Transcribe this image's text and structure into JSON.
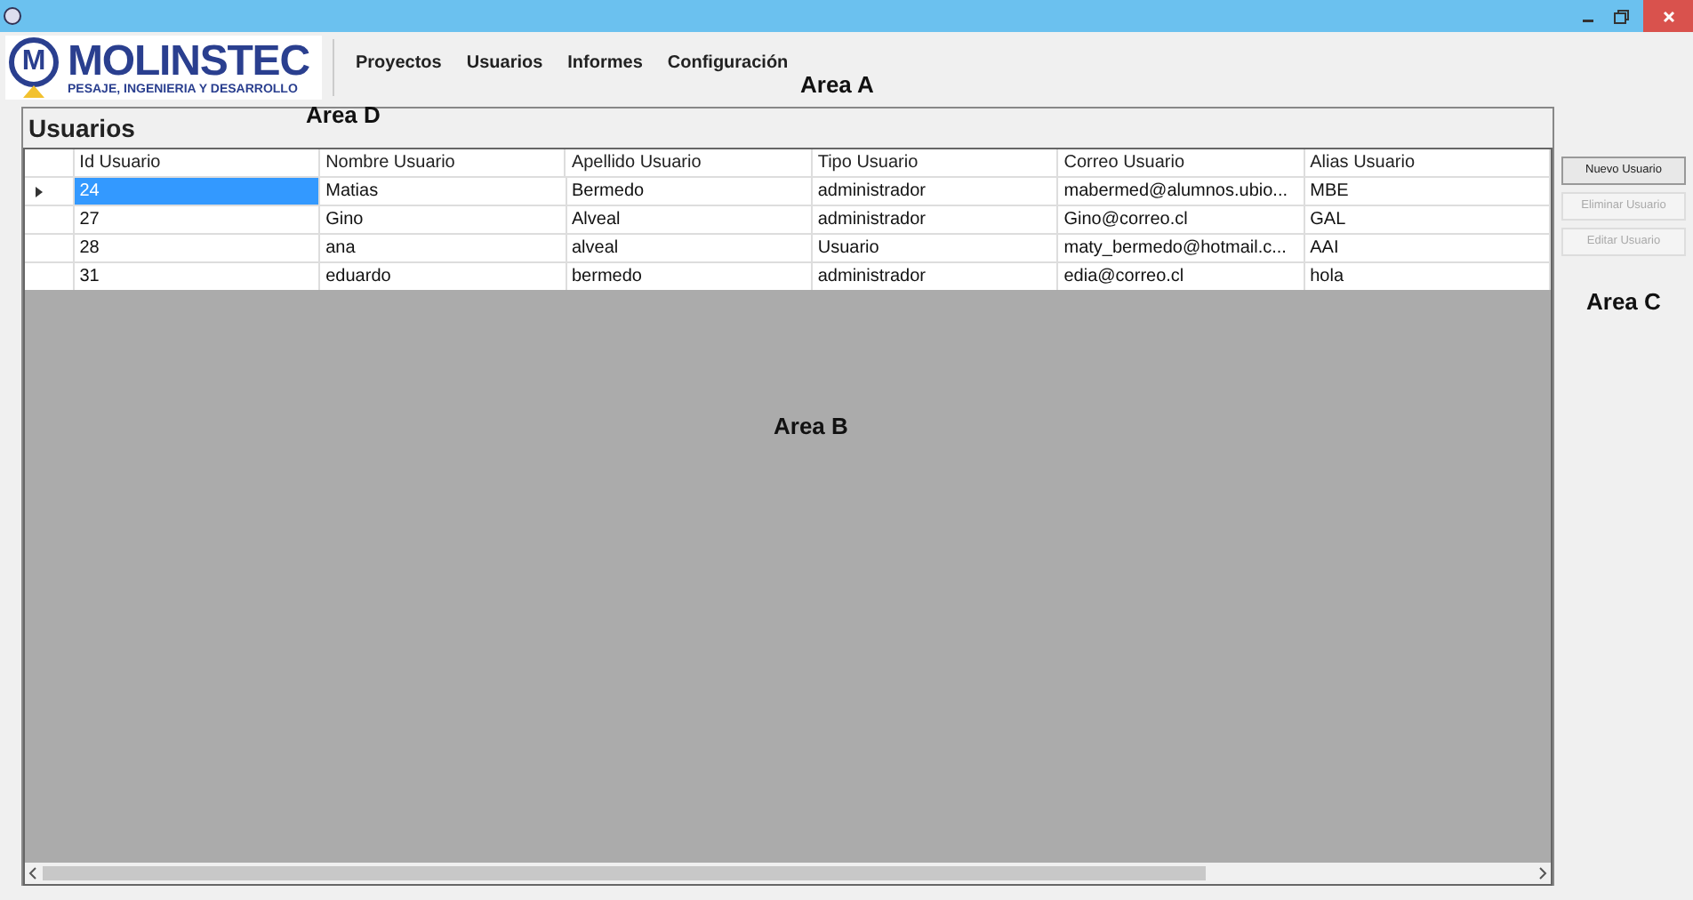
{
  "logo": {
    "mark": "M",
    "name": "MOLINSTEC",
    "tagline": "PESAJE, INGENIERIA Y DESARROLLO"
  },
  "menu": [
    "Proyectos",
    "Usuarios",
    "Informes",
    "Configuración"
  ],
  "annotations": {
    "area_a": "Area A",
    "area_d": "Area D",
    "area_b": "Area B",
    "area_c": "Area C"
  },
  "panel_title": "Usuarios",
  "table": {
    "columns": [
      "Id Usuario",
      "Nombre Usuario",
      "Apellido Usuario",
      "Tipo Usuario",
      "Correo Usuario",
      "Alias Usuario"
    ],
    "rows": [
      {
        "selected": true,
        "cells": [
          "24",
          "Matias",
          "Bermedo",
          "administrador",
          "mabermed@alumnos.ubio...",
          "MBE"
        ]
      },
      {
        "selected": false,
        "cells": [
          "27",
          "Gino",
          "Alveal",
          "administrador",
          "Gino@correo.cl",
          "GAL"
        ]
      },
      {
        "selected": false,
        "cells": [
          "28",
          "ana",
          "alveal",
          "Usuario",
          "maty_bermedo@hotmail.c...",
          "AAI"
        ]
      },
      {
        "selected": false,
        "cells": [
          "31",
          "eduardo",
          "bermedo",
          "administrador",
          "edia@correo.cl",
          "hola"
        ]
      }
    ]
  },
  "buttons": [
    {
      "label": "Nuevo Usuario",
      "disabled": false
    },
    {
      "label": "Eliminar Usuario",
      "disabled": true
    },
    {
      "label": "Editar Usuario",
      "disabled": true
    }
  ]
}
